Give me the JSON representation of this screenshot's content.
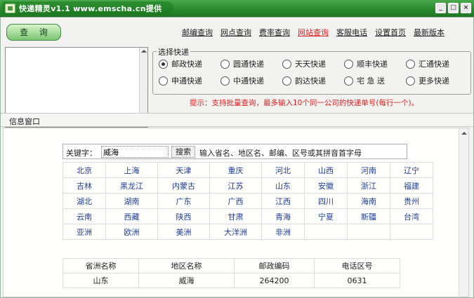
{
  "window": {
    "title": "快递精灵v1.1 www.emscha.cn提供",
    "controls": [
      "_",
      "□",
      "×"
    ]
  },
  "toolbar": {
    "query_label": "查 询"
  },
  "nav": [
    {
      "label": "邮编查询",
      "active": false
    },
    {
      "label": "网点查询",
      "active": false
    },
    {
      "label": "费率查询",
      "active": false
    },
    {
      "label": "网站查询",
      "active": true
    },
    {
      "label": "客服电话",
      "active": false
    },
    {
      "label": "设置首页",
      "active": false
    },
    {
      "label": "最新版本",
      "active": false
    }
  ],
  "select_express": {
    "legend": "选择快递",
    "options": [
      {
        "label": "邮政快递",
        "checked": true
      },
      {
        "label": "圆通快递",
        "checked": false
      },
      {
        "label": "天天快递",
        "checked": false
      },
      {
        "label": "顺丰快递",
        "checked": false
      },
      {
        "label": "汇通快递",
        "checked": false
      },
      {
        "label": "申通快递",
        "checked": false
      },
      {
        "label": "中通快递",
        "checked": false
      },
      {
        "label": "韵达快递",
        "checked": false
      },
      {
        "label": "宅 急 送",
        "checked": false
      },
      {
        "label": "更多快递",
        "checked": false
      }
    ]
  },
  "hint": "提示：支持批量查询，最多输入10个同一公司的快递单号(每行一个)。",
  "info": {
    "title": "信息窗口",
    "keyword_label": "关键字：",
    "keyword_value": "威海",
    "search_label": "搜索",
    "keyword_hint": "输入省名、地区名、邮编、区号或其拼音首字母",
    "regions": [
      [
        "北京",
        "上海",
        "天津",
        "重庆",
        "河北",
        "山西",
        "河南",
        "辽宁"
      ],
      [
        "吉林",
        "黑龙江",
        "内蒙古",
        "江苏",
        "山东",
        "安徽",
        "浙江",
        "福建"
      ],
      [
        "湖北",
        "湖南",
        "广东",
        "广西",
        "江西",
        "四川",
        "海南",
        "贵州"
      ],
      [
        "云南",
        "西藏",
        "陕西",
        "甘肃",
        "青海",
        "宁夏",
        "新疆",
        "台湾"
      ],
      [
        "亚洲",
        "欧洲",
        "美洲",
        "大洋洲",
        "非洲",
        "",
        "",
        ""
      ]
    ],
    "result": {
      "headers": [
        "省洲名称",
        "地区名称",
        "邮政编码",
        "电话区号"
      ],
      "row": [
        "山东",
        "威海",
        "264200",
        "0631"
      ]
    }
  }
}
